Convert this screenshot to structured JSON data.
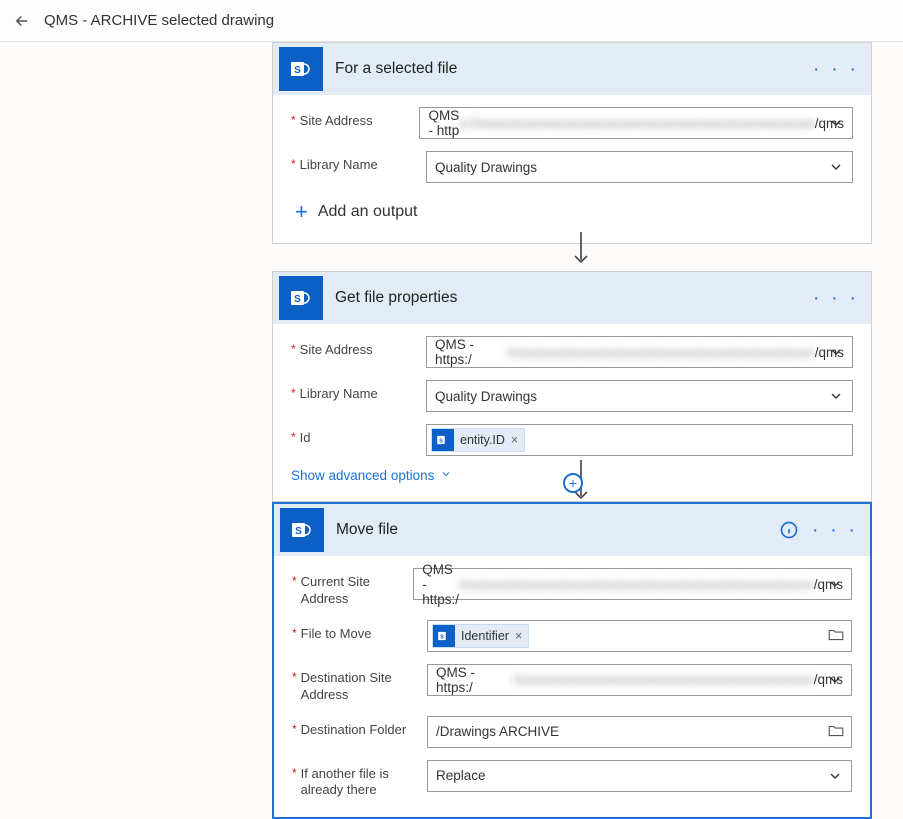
{
  "header": {
    "title": "QMS - ARCHIVE selected drawing"
  },
  "card1": {
    "title": "For a selected file",
    "site_address_label": "Site Address",
    "site_address_value_pre": "QMS - http",
    "site_address_value_blur": "s://xxxxxxxxxxxxxxxxxxxxxxxxxxxxxxxxxxxxxxxxxxxxxxxxxx",
    "site_address_value_post": "/qms",
    "library_label": "Library Name",
    "library_value": "Quality Drawings",
    "add_output": "Add an output"
  },
  "card2": {
    "title": "Get file properties",
    "site_address_label": "Site Address",
    "site_address_value_pre": "QMS - https:/",
    "site_address_value_blur": "/xxxxxxxxxxxxxxxxxxxxxxxxxxxxxxxxxxxxxxxxxxxxx",
    "site_address_value_post": "/qms",
    "library_label": "Library Name",
    "library_value": "Quality Drawings",
    "id_label": "Id",
    "id_token": "entity.ID",
    "advanced": "Show advanced options"
  },
  "card3": {
    "title": "Move file",
    "curr_site_label": "Current Site Address",
    "curr_site_pre": "QMS - https:/",
    "curr_site_blur": "/xxxxxxxxxxxxxxxxxxxxxxxxxxxxxxxxxxxxxxxxxxxxxxxxxxxx",
    "curr_site_post": "/qms",
    "file_move_label": "File to Move",
    "file_move_token": "Identifier",
    "dest_site_label": "Destination Site Address",
    "dest_site_pre": "QMS - https:/",
    "dest_site_blur": "/xxxxxxxxxxxxxxxxxxxxxxxxxxxxxxxxxxxxxxxxxxxx",
    "dest_site_post": "/qms",
    "dest_folder_label": "Destination Folder",
    "dest_folder_value": "/Drawings ARCHIVE",
    "overwrite_label": "If another file is already there",
    "overwrite_value": "Replace"
  }
}
